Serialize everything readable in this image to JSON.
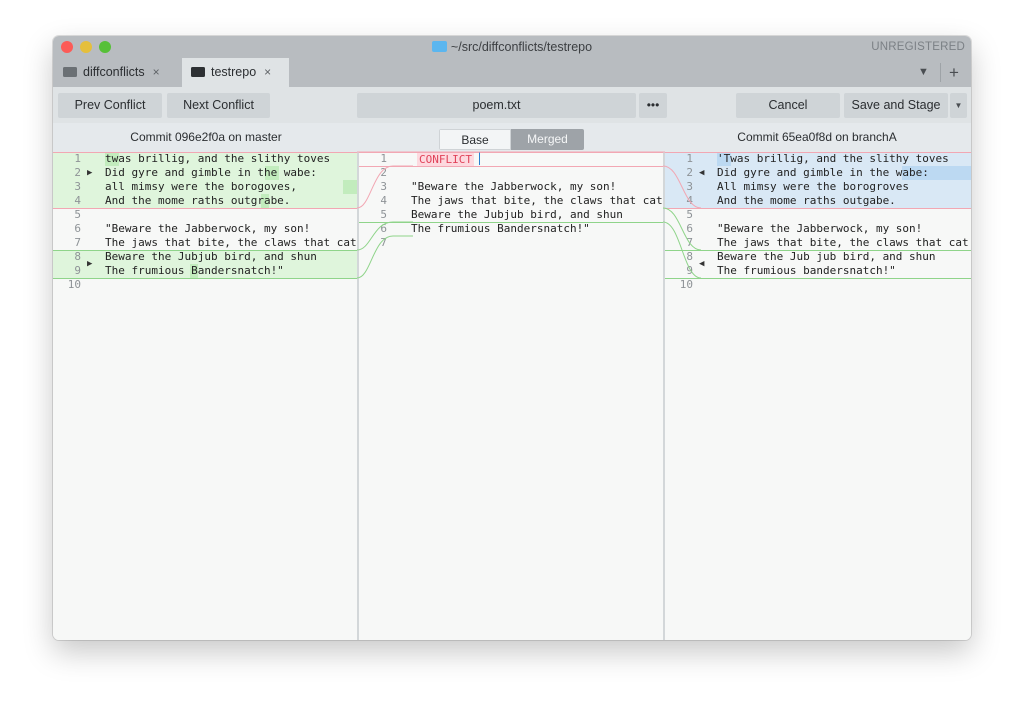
{
  "window": {
    "title": "~/src/diffconflicts/testrepo",
    "registration": "UNREGISTERED"
  },
  "tabs": [
    {
      "label": "diffconflicts",
      "close": "×",
      "active": false
    },
    {
      "label": "testrepo",
      "close": "×",
      "active": true
    }
  ],
  "tabbar": {
    "menu_glyph": "▼",
    "add_glyph": "+"
  },
  "toolbar": {
    "prev_label": "Prev Conflict",
    "next_label": "Next Conflict",
    "file_label": "poem.txt",
    "more_label": "•••",
    "cancel_label": "Cancel",
    "save_label": "Save and Stage",
    "save_menu_glyph": "▼"
  },
  "headers": {
    "left": "Commit 096e2f0a on master",
    "right": "Commit 65ea0f8d on branchA",
    "view_base": "Base",
    "view_merged": "Merged",
    "selected_view": "Merged"
  },
  "left_pane": {
    "lines": [
      {
        "n": "1",
        "text": "twas brillig, and the slithy toves"
      },
      {
        "n": "2",
        "text": "Did gyre and gimble in the wabe:"
      },
      {
        "n": "3",
        "text": "all mimsy were the borogoves,"
      },
      {
        "n": "4",
        "text": "And the mome raths outgrabe."
      },
      {
        "n": "5",
        "text": ""
      },
      {
        "n": "6",
        "text": "\"Beware the Jabberwock, my son!"
      },
      {
        "n": "7",
        "text": "The jaws that bite, the claws that cat"
      },
      {
        "n": "8",
        "text": "Beware the Jubjub bird, and shun"
      },
      {
        "n": "9",
        "text": "The frumious Bandersnatch!\""
      },
      {
        "n": "10",
        "text": ""
      }
    ]
  },
  "merged_pane": {
    "conflict_label": "CONFLICT",
    "lines": [
      {
        "n": "1",
        "text": ""
      },
      {
        "n": "2",
        "text": ""
      },
      {
        "n": "3",
        "text": "\"Beware the Jabberwock, my son!"
      },
      {
        "n": "4",
        "text": "The jaws that bite, the claws that cat"
      },
      {
        "n": "5",
        "text": "Beware the Jubjub bird, and shun"
      },
      {
        "n": "6",
        "text": "The frumious Bandersnatch!\""
      },
      {
        "n": "7",
        "text": ""
      }
    ]
  },
  "right_pane": {
    "lines": [
      {
        "n": "1",
        "text": "'Twas brillig, and the slithy toves"
      },
      {
        "n": "2",
        "text": "Did gyre and gimble in the wabe:"
      },
      {
        "n": "3",
        "text": "All mimsy were the borogroves"
      },
      {
        "n": "4",
        "text": "And the mome raths outgabe."
      },
      {
        "n": "5",
        "text": ""
      },
      {
        "n": "6",
        "text": "\"Beware the Jabberwock, my son!"
      },
      {
        "n": "7",
        "text": "The jaws that bite, the claws that cat"
      },
      {
        "n": "8",
        "text": "Beware the Jub jub bird, and shun"
      },
      {
        "n": "9",
        "text": "The frumious bandersnatch!\""
      },
      {
        "n": "10",
        "text": ""
      }
    ]
  },
  "colors": {
    "added_bg": "#dff5dc",
    "added_strong": "#c2ecbd",
    "changed_bg": "#d9e8f5",
    "changed_strong": "#bcd9f2",
    "conflict_line": "#f2a7b3",
    "green_line": "#8fd48a"
  }
}
